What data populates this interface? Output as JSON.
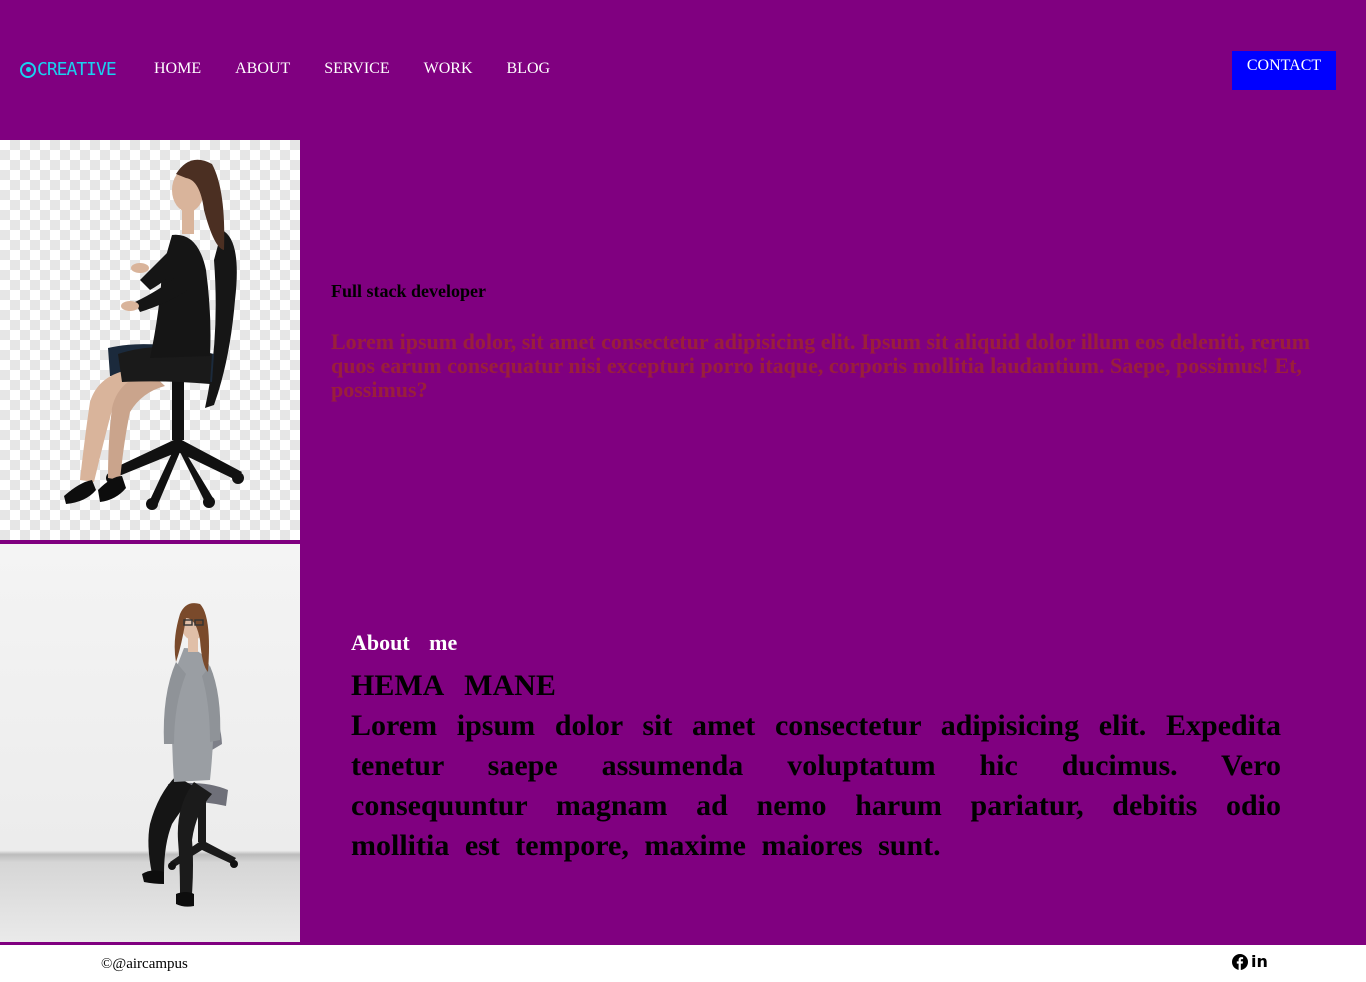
{
  "brand": {
    "name": "CREATIVE",
    "color": "#1ad1f0"
  },
  "nav": {
    "items": [
      {
        "label": "HOME"
      },
      {
        "label": "ABOUT"
      },
      {
        "label": "SERVICE"
      },
      {
        "label": "WORK"
      },
      {
        "label": "BLOG"
      }
    ],
    "contact_label": "CONTACT"
  },
  "hero": {
    "subtitle": "Full stack developer",
    "text": "Lorem ipsum dolor, sit amet consectetur adipisicing elit. Ipsum sit aliquid dolor illum eos deleniti, rerum quos earum consequatur nisi excepturi porro itaque, corporis mollitia laudantium. Saepe, possimus! Et, possimus?"
  },
  "about": {
    "label": "About me",
    "name": "HEMA MANE",
    "text": "Lorem ipsum dolor sit amet consectetur adipisicing elit. Expedita tenetur saepe assumenda voluptatum hic ducimus. Vero consequuntur magnam ad nemo harum pariatur, debitis odio mollitia est tempore, maxime maiores sunt."
  },
  "footer": {
    "copyright": "©@aircampus",
    "social": {
      "linkedin_label": "in"
    }
  },
  "images": {
    "top": "woman-sitting-in-office-chair-side-view",
    "bottom": "woman-sitting-in-chair-front-view"
  },
  "colors": {
    "background": "#800080",
    "contact_button": "#0000ff",
    "hero_text": "#9a1f3b",
    "footer_bg": "#ffffff"
  }
}
